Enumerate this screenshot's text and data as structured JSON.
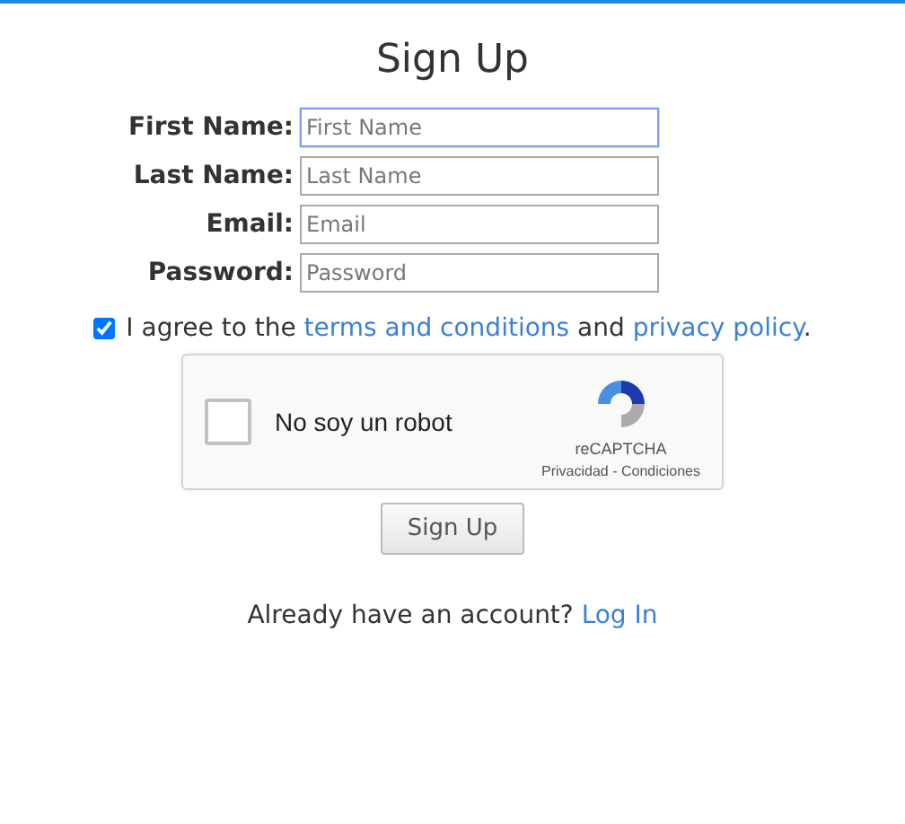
{
  "title": "Sign Up",
  "fields": [
    {
      "label": "First Name:",
      "placeholder": "First Name",
      "focused": true
    },
    {
      "label": "Last Name:",
      "placeholder": "Last Name",
      "focused": false
    },
    {
      "label": "Email:",
      "placeholder": "Email",
      "focused": false
    },
    {
      "label": "Password:",
      "placeholder": "Password",
      "focused": false
    }
  ],
  "agree": {
    "checked": true,
    "before": "I agree to the",
    "link1": "terms and conditions",
    "middle": "and",
    "link2": "privacy policy",
    "after": "."
  },
  "captcha": {
    "checked": false,
    "label": "No soy un robot",
    "brand": "reCAPTCHA",
    "links": "Privacidad - Condiciones"
  },
  "submit": "Sign Up",
  "login": {
    "text": "Already have an account?",
    "link": "Log In"
  }
}
